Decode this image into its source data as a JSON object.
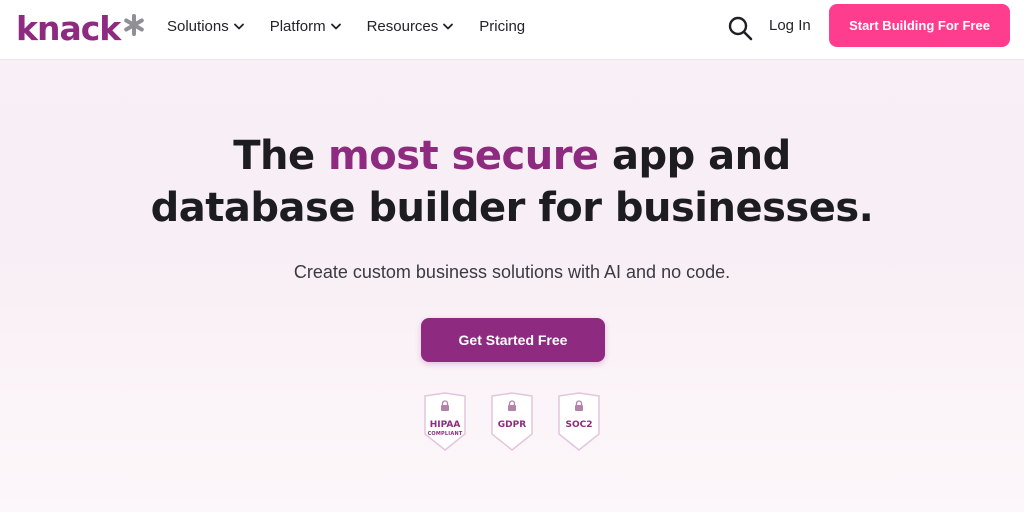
{
  "brand": {
    "name": "knack",
    "color": "#8e2a7f"
  },
  "nav": {
    "items": [
      {
        "label": "Solutions",
        "has_dropdown": true
      },
      {
        "label": "Platform",
        "has_dropdown": true
      },
      {
        "label": "Resources",
        "has_dropdown": true
      },
      {
        "label": "Pricing",
        "has_dropdown": false
      }
    ],
    "search_icon": "search-icon",
    "login_label": "Log In",
    "cta_label": "Start Building For Free",
    "cta_color": "#ff3d8f"
  },
  "hero": {
    "headline_pre": "The ",
    "headline_accent": "most secure",
    "headline_post_line1": " app and",
    "headline_line2": "database builder for businesses.",
    "subheadline": "Create custom business solutions with AI and no code.",
    "cta_label": "Get Started Free",
    "cta_color": "#8e2a7f"
  },
  "badges": [
    {
      "label": "HIPAA",
      "sublabel": "COMPLIANT",
      "icon": "lock-icon"
    },
    {
      "label": "GDPR",
      "sublabel": "",
      "icon": "lock-icon"
    },
    {
      "label": "SOC2",
      "sublabel": "",
      "icon": "lock-icon"
    }
  ]
}
